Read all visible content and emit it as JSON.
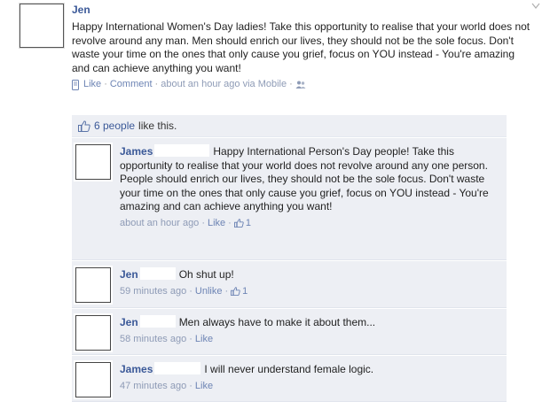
{
  "post": {
    "author": "Jen",
    "text": "Happy International Women's Day ladies! Take this opportunity to realise that your world does not revolve around any man. Men should enrich our lives, they should not be the sole focus. Don't waste your time on the ones that only cause you grief, focus on YOU instead - You're amazing and can achieve anything you want!",
    "like_label": "Like",
    "comment_label": "Comment",
    "timestamp": "about an hour ago via Mobile",
    "sep": "·"
  },
  "likes": {
    "text": "6 people",
    "suffix": "like this."
  },
  "comments": [
    {
      "author": "James",
      "text": "Happy International Person's Day people! Take this opportunity to realise that your world does not revolve around any one person. People should enrich our lives, they should not be the sole focus. Don't waste your time on the ones that only cause you grief, focus on YOU instead - You're amazing and can achieve anything you want!",
      "time": "about an hour ago",
      "action": "Like",
      "likes": "1"
    },
    {
      "author": "Jen",
      "text": "Oh shut up!",
      "time": "59 minutes ago",
      "action": "Unlike",
      "likes": "1"
    },
    {
      "author": "Jen",
      "text": "Men always have to make it about them...",
      "time": "58 minutes ago",
      "action": "Like"
    },
    {
      "author": "James",
      "text": "I will never understand female logic.",
      "time": "47 minutes ago",
      "action": "Like"
    }
  ],
  "icons": {
    "close": "close-icon",
    "thumb": "thumbs-up-icon",
    "mobile": "mobile-phone-icon",
    "audience": "friends-icon"
  },
  "colors": {
    "link": "#3b5998",
    "meta": "#8e9bb6",
    "feedback_bg": "#edeff4"
  }
}
